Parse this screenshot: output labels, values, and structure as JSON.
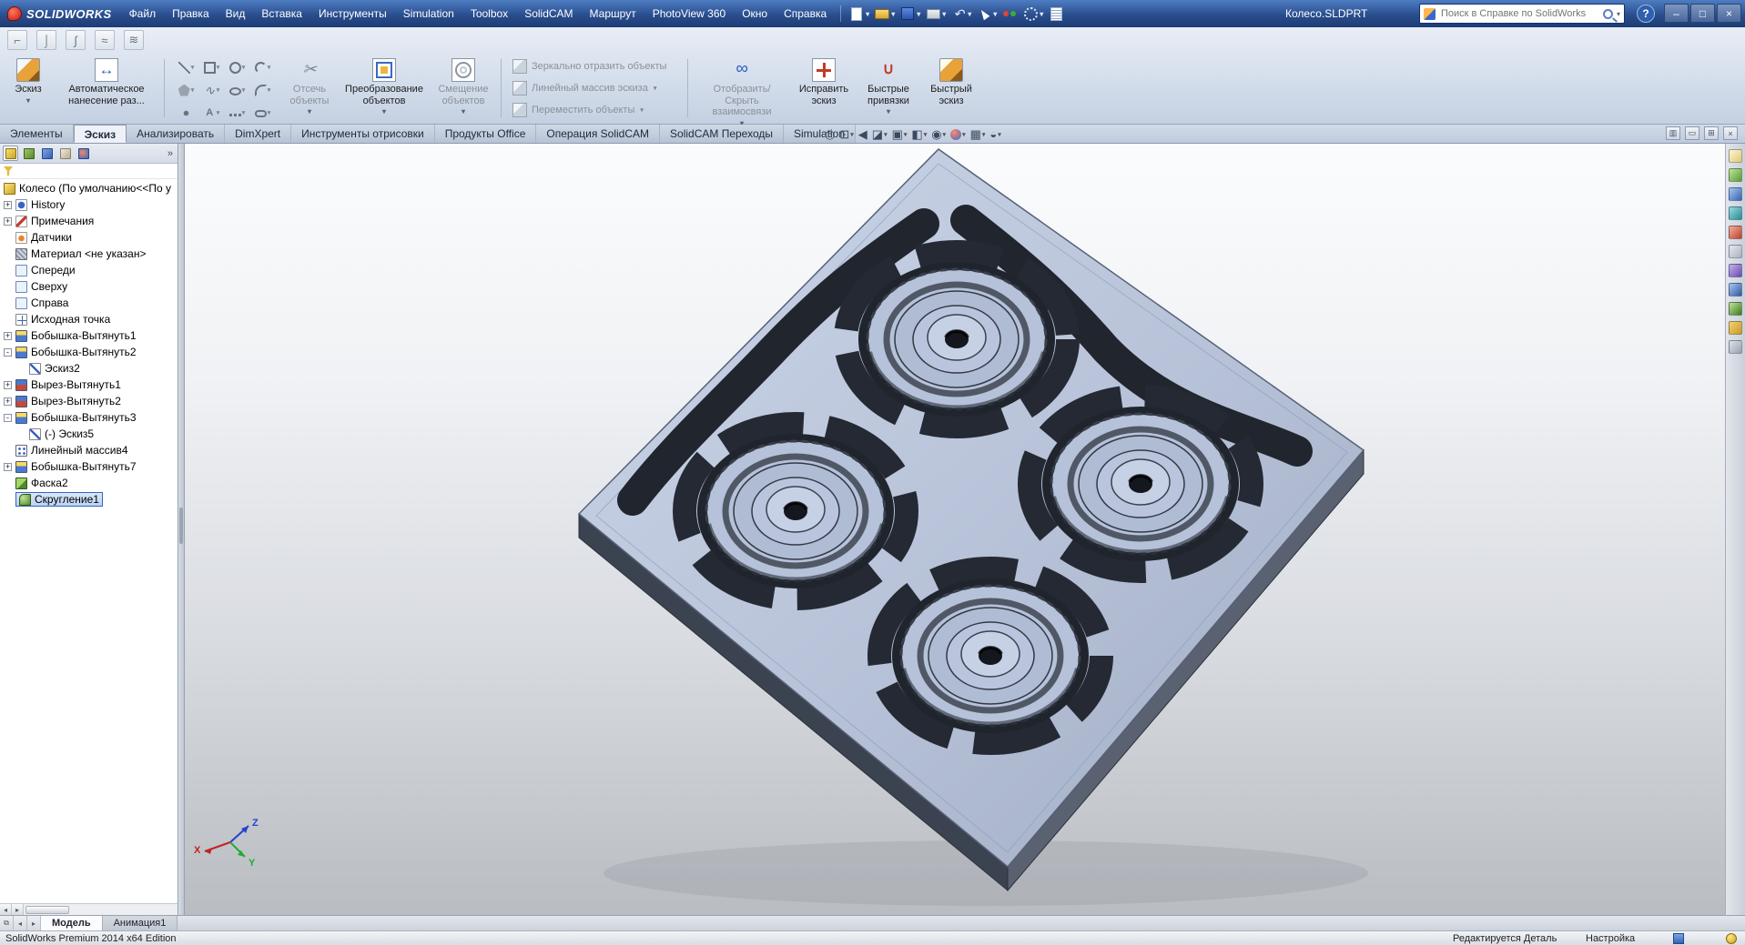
{
  "window": {
    "brand": "SOLIDWORKS",
    "title": "Колесо.SLDPRT",
    "search_placeholder": "Поиск в Справке по SolidWorks",
    "help": "?"
  },
  "menus": [
    "Файл",
    "Правка",
    "Вид",
    "Вставка",
    "Инструменты",
    "Simulation",
    "Toolbox",
    "SolidCAM",
    "Маршрут",
    "PhotoView 360",
    "Окно",
    "Справка"
  ],
  "menubar_icons": [
    "new-document-icon",
    "open-icon",
    "save-icon",
    "print-icon",
    "undo-icon",
    "select-cursor-icon",
    "rebuild-icon",
    "options-icon",
    "file-properties-icon"
  ],
  "ribbon": {
    "sketch": "Эскиз",
    "auto_dim": "Автоматическое нанесение раз...",
    "trim": "Отсечь объекты",
    "convert": "Преобразование объектов",
    "offset": "Смещение объектов",
    "mirror": "Зеркально отразить объекты",
    "linear_pattern": "Линейный массив эскиза",
    "move": "Переместить объекты",
    "relations": "Отобразить/Скрыть взаимосвязи",
    "repair": "Исправить эскиз",
    "snaps": "Быстрые привязки",
    "rapid": "Быстрый эскиз"
  },
  "entity_icons": [
    "line-icon",
    "rectangle-icon",
    "circle-icon",
    "arc-icon",
    "polygon-icon",
    "spline-icon",
    "ellipse-icon",
    "sketch-fillet-icon",
    "point-icon",
    "text-icon",
    "centerline-icon",
    "slot-icon"
  ],
  "command_tabs": [
    "Элементы",
    "Эскиз",
    "Анализировать",
    "DimXpert",
    "Инструменты отрисовки",
    "Продукты Office",
    "Операция SolidCAM",
    "SolidCAM Переходы",
    "Simulation"
  ],
  "headsup_icons": [
    "zoom-fit-icon",
    "zoom-area-icon",
    "previous-view-icon",
    "section-view-icon",
    "view-orientation-icon",
    "display-style-icon",
    "hide-show-items-icon",
    "edit-appearance-icon",
    "apply-scene-icon",
    "view-settings-icon"
  ],
  "tree": {
    "root": "Колесо  (По умолчанию<<По у",
    "items": [
      {
        "exp": "+",
        "icon": "history-icon",
        "label": "History"
      },
      {
        "exp": "+",
        "icon": "annotations-icon",
        "label": "Примечания"
      },
      {
        "exp": "",
        "icon": "sensors-icon",
        "label": "Датчики"
      },
      {
        "exp": "",
        "icon": "material-icon",
        "label": "Материал <не указан>"
      },
      {
        "exp": "",
        "icon": "plane-icon",
        "label": "Спереди"
      },
      {
        "exp": "",
        "icon": "plane-icon",
        "label": "Сверху"
      },
      {
        "exp": "",
        "icon": "plane-icon",
        "label": "Справа"
      },
      {
        "exp": "",
        "icon": "origin-icon",
        "label": "Исходная точка"
      },
      {
        "exp": "+",
        "icon": "boss-extrude-icon",
        "label": "Бобышка-Вытянуть1"
      },
      {
        "exp": "-",
        "icon": "boss-extrude-icon",
        "label": "Бобышка-Вытянуть2"
      },
      {
        "exp": "",
        "icon": "sketch-icon",
        "label": "Эскиз2"
      },
      {
        "exp": "+",
        "icon": "cut-extrude-icon",
        "label": "Вырез-Вытянуть1"
      },
      {
        "exp": "+",
        "icon": "cut-extrude-icon",
        "label": "Вырез-Вытянуть2"
      },
      {
        "exp": "-",
        "icon": "boss-extrude-icon",
        "label": "Бобышка-Вытянуть3"
      },
      {
        "exp": "",
        "icon": "sketch-icon",
        "label": "(-) Эскиз5"
      },
      {
        "exp": "",
        "icon": "pattern-icon",
        "label": "Линейный массив4"
      },
      {
        "exp": "+",
        "icon": "boss-extrude-icon",
        "label": "Бобышка-Вытянуть7"
      },
      {
        "exp": "",
        "icon": "chamfer-icon",
        "label": "Фаска2"
      },
      {
        "exp": "",
        "icon": "fillet-icon",
        "label": "Скругление1"
      }
    ]
  },
  "bottom_tabs": {
    "model": "Модель",
    "animation": "Анимация1"
  },
  "status": {
    "edition": "SolidWorks Premium 2014 x64 Edition",
    "mode": "Редактируется Деталь",
    "settings": "Настройка"
  },
  "triad": {
    "x": "X",
    "y": "Y",
    "z": "Z"
  },
  "colors": {
    "part": "#b6c2da",
    "recess": "#23272f",
    "accent_blue": "#2f5a9e"
  }
}
